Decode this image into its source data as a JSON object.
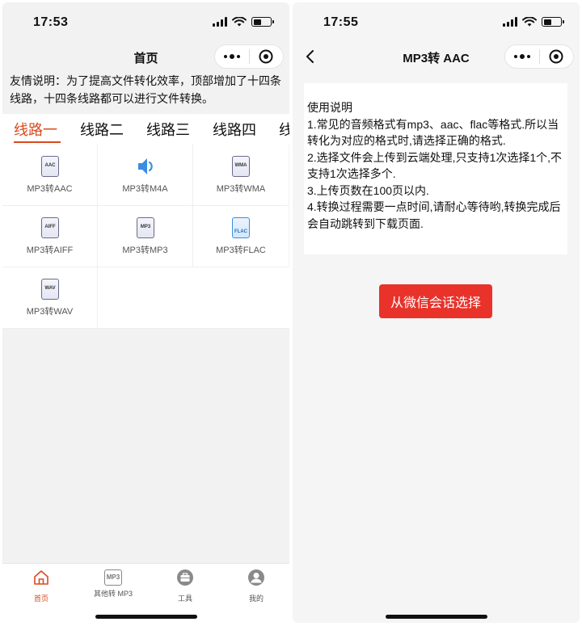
{
  "left": {
    "status": {
      "time": "17:53"
    },
    "nav": {
      "title": "首页"
    },
    "notice": "友情说明：为了提高文件转化效率，顶部增加了十四条线路，十四条线路都可以进行文件转换。",
    "tabs": [
      {
        "label": "线路一"
      },
      {
        "label": "线路二"
      },
      {
        "label": "线路三"
      },
      {
        "label": "线路四"
      },
      {
        "label": "线"
      }
    ],
    "grid": [
      {
        "label": "MP3转AAC",
        "icon_text": "AAC",
        "icon": "aac-file-icon"
      },
      {
        "label": "MP3转M4A",
        "icon_text": "",
        "icon": "speaker-icon"
      },
      {
        "label": "MP3转WMA",
        "icon_text": "WMA",
        "icon": "wma-file-icon"
      },
      {
        "label": "MP3转AIFF",
        "icon_text": "AIFF",
        "icon": "aiff-file-icon"
      },
      {
        "label": "MP3转MP3",
        "icon_text": "MP3",
        "icon": "mp3-file-icon"
      },
      {
        "label": "MP3转FLAC",
        "icon_text": "FLAC",
        "icon": "flac-file-icon"
      },
      {
        "label": "MP3转WAV",
        "icon_text": "WAV",
        "icon": "wav-file-icon"
      }
    ],
    "tabbar": [
      {
        "label": "首页",
        "icon": "home-icon",
        "active": true
      },
      {
        "label": "其他转 MP3",
        "icon": "mp3-icon",
        "icon_text": "MP3",
        "active": false
      },
      {
        "label": "工具",
        "icon": "toolbox-icon",
        "active": false
      },
      {
        "label": "我的",
        "icon": "user-icon",
        "active": false
      }
    ]
  },
  "right": {
    "status": {
      "time": "17:55"
    },
    "nav": {
      "title": "MP3转 AAC"
    },
    "instructions": [
      "使用说明",
      "1.常见的音频格式有mp3、aac、flac等格式.所以当转化为对应的格式时,请选择正确的格式.",
      "2.选择文件会上传到云端处理,只支持1次选择1个,不支持1次选择多个.",
      "3.上传页数在100页以内.",
      "4.转换过程需要一点时间,请耐心等待哟,转换完成后会自动跳转到下载页面."
    ],
    "pick_button": "从微信会话选择"
  },
  "colors": {
    "accent": "#d94a1e",
    "button_red": "#e8322a",
    "speaker_blue": "#3a8ee0"
  }
}
